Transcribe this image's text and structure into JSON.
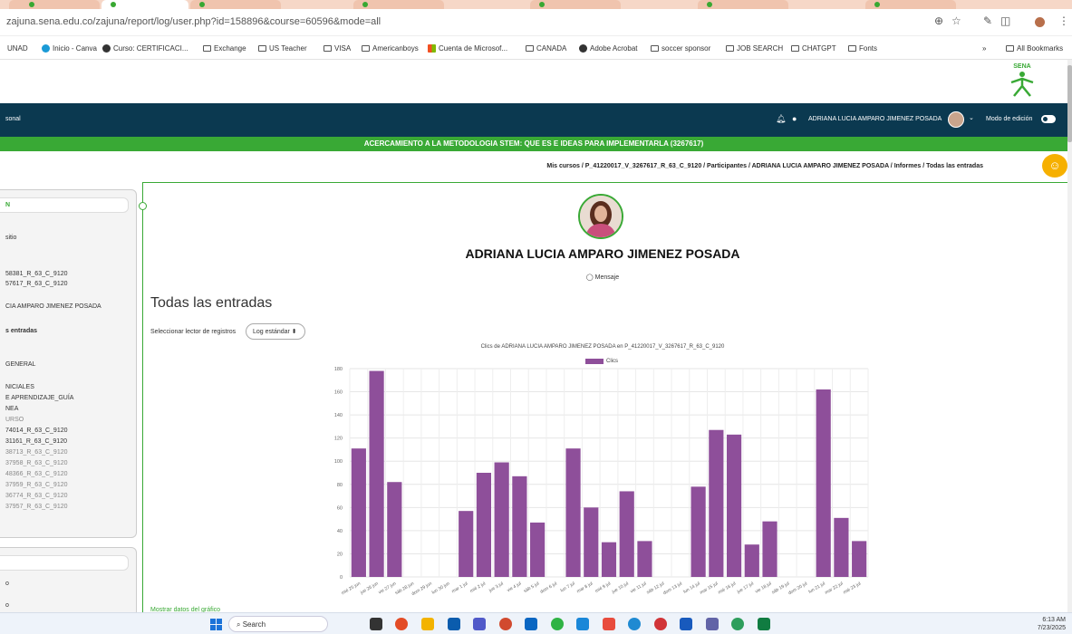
{
  "browser": {
    "url": "zajuna.sena.edu.co/zajuna/report/log/user.php?id=158896&course=60596&mode=all",
    "bookmarks": [
      "UNAD",
      "Inicio - Canva",
      "Curso: CERTIFICACI...",
      "Exchange",
      "US Teacher",
      "VISA",
      "Americanboys",
      "Cuenta de Microsof...",
      "CANADA",
      "Adobe Acrobat",
      "soccer sponsor",
      "JOB SEARCH",
      "CHATGPT",
      "Fonts"
    ],
    "overflow": "»",
    "all_bookmarks": "All Bookmarks"
  },
  "header": {
    "logo_text": "SENA",
    "nav_left": "sonal",
    "user_name": "ADRIANA LUCIA AMPARO JIMENEZ POSADA",
    "edit_mode_label": "Modo de edición",
    "course_title": "ACERCAMIENTO A LA METODOLOGIA STEM: QUE ES E IDEAS PARA IMPLEMENTARLA (3267617)",
    "breadcrumb": "Mis cursos  /  P_41220017_V_3267617_R_63_C_9120  /  Participantes  /  ADRIANA LUCIA AMPARO JIMENEZ POSADA  /  Informes  /  Todas las entradas"
  },
  "sidebar": {
    "header": "N",
    "items": [
      {
        "label": "sitio",
        "style": ""
      },
      {
        "label": "58381_R_63_C_9120",
        "style": ""
      },
      {
        "label": "57617_R_63_C_9120",
        "style": ""
      },
      {
        "label": "CIA AMPARO JIMENEZ POSADA",
        "style": ""
      },
      {
        "label": "s entradas",
        "style": "b"
      },
      {
        "label": "GENERAL",
        "style": ""
      },
      {
        "label": "NICIALES",
        "style": ""
      },
      {
        "label": "E APRENDIZAJE_GUÍA",
        "style": ""
      },
      {
        "label": "NEA",
        "style": ""
      },
      {
        "label": "URSO",
        "style": "g"
      },
      {
        "label": "74014_R_63_C_9120",
        "style": ""
      },
      {
        "label": "31161_R_63_C_9120",
        "style": ""
      },
      {
        "label": "38713_R_63_C_9120",
        "style": "g"
      },
      {
        "label": "37958_R_63_C_9120",
        "style": "g"
      },
      {
        "label": "48366_R_63_C_9120",
        "style": "g"
      },
      {
        "label": "37959_R_63_C_9120",
        "style": "g"
      },
      {
        "label": "36774_R_63_C_9120",
        "style": "g"
      },
      {
        "label": "37957_R_63_C_9120",
        "style": "g"
      }
    ],
    "bottom_items": [
      "o",
      "o"
    ]
  },
  "profile": {
    "name": "ADRIANA LUCIA AMPARO JIMENEZ POSADA",
    "message_label": "Mensaje"
  },
  "page": {
    "title": "Todas las entradas",
    "log_reader_label": "Seleccionar lector de registros",
    "log_reader_value": "Log estándar ⬍",
    "show_data_link": "Mostrar datos del gráfico"
  },
  "chart_data": {
    "type": "bar",
    "title": "Clics de ADRIANA LUCIA AMPARO JIMENEZ POSADA  en P_41220017_V_3267617_R_63_C_9120",
    "legend": [
      "Clics"
    ],
    "color": "#8e4f9a",
    "ylim": [
      0,
      180
    ],
    "yticks": [
      0,
      20,
      40,
      60,
      80,
      100,
      120,
      140,
      160,
      180
    ],
    "categories": [
      "mié 25 jun",
      "jue 26 jun",
      "vie 27 jun",
      "sáb 28 jun",
      "dom 29 jun",
      "lun 30 jun",
      "mar 1 jul",
      "mié 2 jul",
      "jue 3 jul",
      "vie 4 jul",
      "sáb 5 jul",
      "dom 6 jul",
      "lun 7 jul",
      "mar 8 jul",
      "mié 9 jul",
      "jue 10 jul",
      "vie 11 jul",
      "sáb 12 jul",
      "dom 13 jul",
      "lun 14 jul",
      "mar 15 jul",
      "mié 16 jul",
      "jue 17 jul",
      "vie 18 jul",
      "sáb 19 jul",
      "dom 20 jul",
      "lun 21 jul",
      "mar 22 jul",
      "mié 23 jul"
    ],
    "series": [
      {
        "name": "Clics",
        "values": [
          111,
          178,
          82,
          0,
          0,
          0,
          57,
          90,
          99,
          87,
          47,
          0,
          111,
          60,
          30,
          74,
          31,
          0,
          0,
          78,
          127,
          123,
          28,
          48,
          0,
          0,
          162,
          51,
          31
        ]
      }
    ],
    "grid": true,
    "legend_position": "top"
  },
  "taskbar": {
    "search_placeholder": "Search",
    "time": "6:13 AM",
    "date": "7/23/2025"
  }
}
